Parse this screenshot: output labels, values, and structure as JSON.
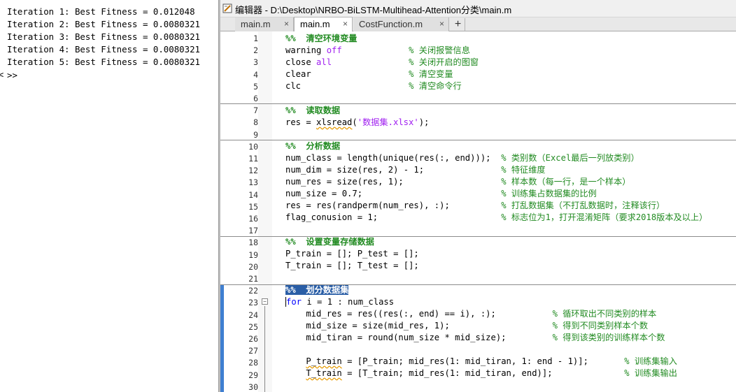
{
  "command_window": {
    "lines": [
      "Iteration 1: Best Fitness = 0.012048",
      "Iteration 2: Best Fitness = 0.0080321",
      "Iteration 3: Best Fitness = 0.0080321",
      "Iteration 4: Best Fitness = 0.0080321",
      "Iteration 5: Best Fitness = 0.0080321"
    ],
    "prompt": ">>",
    "left_marker": "<"
  },
  "editor": {
    "title": "编辑器 - D:\\Desktop\\NRBO-BiLSTM-Multihead-Attention分类\\main.m",
    "tabs": [
      {
        "label": "main.m",
        "close": "×"
      },
      {
        "label": "main.m",
        "close": "×"
      },
      {
        "label": "CostFunction.m",
        "close": "×"
      }
    ],
    "add_tab": "+",
    "line_numbers": [
      "1",
      "2",
      "3",
      "4",
      "5",
      "6",
      "7",
      "8",
      "9",
      "10",
      "11",
      "12",
      "13",
      "14",
      "15",
      "16",
      "17",
      "18",
      "19",
      "20",
      "21",
      "22",
      "23",
      "24",
      "25",
      "26",
      "27",
      "28",
      "29",
      "30"
    ],
    "fold_marker": "−",
    "code": {
      "l1": {
        "text": "%%  清空环境变量"
      },
      "l2": {
        "a": "warning ",
        "b": "off",
        "c": "             ",
        "d": "% 关闭报警信息"
      },
      "l3": {
        "a": "close ",
        "b": "all",
        "c": "               ",
        "d": "% 关闭开启的图窗"
      },
      "l4": {
        "a": "clear                   ",
        "d": "% 清空变量"
      },
      "l5": {
        "a": "clc                     ",
        "d": "% 清空命令行"
      },
      "l7": {
        "text": "%%  读取数据"
      },
      "l8": {
        "a": "res = ",
        "b": "xlsread",
        "c": "(",
        "d": "'数据集.xlsx'",
        "e": ");"
      },
      "l10": {
        "text": "%%  分析数据"
      },
      "l11": {
        "a": "num_class = length(unique(res(:, end)));  ",
        "d": "% 类别数（Excel最后一列放类别）"
      },
      "l12": {
        "a": "num_dim = size(res, 2) - 1;               ",
        "d": "% 特征维度"
      },
      "l13": {
        "a": "num_res = size(res, 1);                   ",
        "d": "% 样本数（每一行，是一个样本）"
      },
      "l14": {
        "a": "num_size = 0.7;                           ",
        "d": "% 训练集占数据集的比例"
      },
      "l15": {
        "a": "res = res(randperm(num_res), :);          ",
        "d": "% 打乱数据集（不打乱数据时，注释该行）"
      },
      "l16": {
        "a": "flag_conusion = 1;                        ",
        "d": "% 标志位为1，打开混淆矩阵（要求2018版本及以上）"
      },
      "l18": {
        "text": "%%  设置变量存储数据"
      },
      "l19": {
        "a": "P_train = []; P_test = [];"
      },
      "l20": {
        "a": "T_train = []; T_test = [];"
      },
      "l22": {
        "text": "%%  划分数据集"
      },
      "l23": {
        "a": "for",
        "b": " i = 1 : num_class"
      },
      "l24": {
        "a": "    mid_res = res((res(:, end) == i), :);           ",
        "d": "% 循环取出不同类别的样本"
      },
      "l25": {
        "a": "    mid_size = size(mid_res, 1);                    ",
        "d": "% 得到不同类别样本个数"
      },
      "l26": {
        "a": "    mid_tiran = round(num_size * mid_size);         ",
        "d": "% 得到该类别的训练样本个数"
      },
      "l28": {
        "a": "    ",
        "b": "P_train",
        "c": " = [P_train; mid_res(1: mid_tiran, 1: end - 1)];       ",
        "d": "% 训练集输入"
      },
      "l29": {
        "a": "    ",
        "b": "T_train",
        "c": " = [T_train; mid_res(1: mid_tiran, end)];              ",
        "d": "% 训练集输出"
      }
    }
  },
  "colors": {
    "keyword": "#0000ff",
    "string": "#a020f0",
    "comment": "#228b22",
    "selection": "#2a5ea6",
    "cell_bar": "#3f7fd1"
  }
}
